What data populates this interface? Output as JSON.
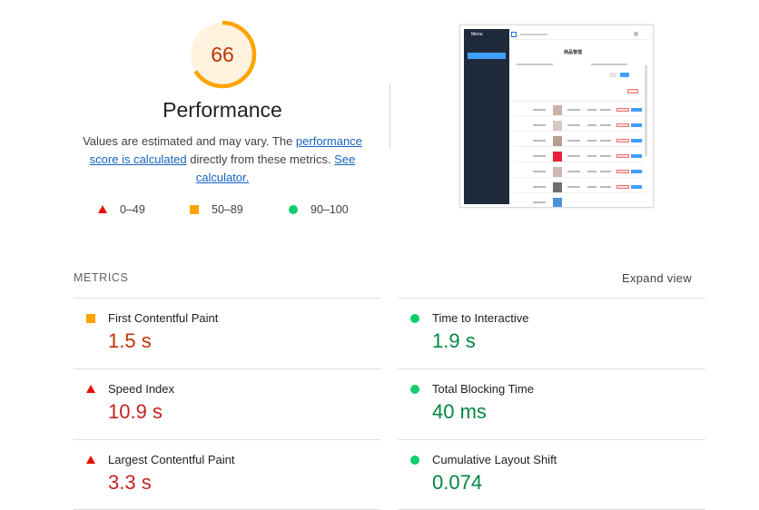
{
  "performance": {
    "score": "66",
    "score_fraction": 0.66,
    "gauge_color": "#ffa400",
    "title": "Performance",
    "desc_prefix": "Values are estimated and may vary. The ",
    "desc_link1": "performance score is calculated",
    "desc_middle": " directly from these metrics. ",
    "desc_link2": "See calculator."
  },
  "legend": [
    {
      "shape": "triangle",
      "color": "#eb0f00",
      "label": "0–49"
    },
    {
      "shape": "square",
      "color": "#ffa400",
      "label": "50–89"
    },
    {
      "shape": "circle",
      "color": "#0cce6b",
      "label": "90–100"
    }
  ],
  "thumbnail": {
    "menu_title": "Menu",
    "page_title": "商品管理"
  },
  "metrics_section": {
    "header": "METRICS",
    "expand_label": "Expand view"
  },
  "metrics": [
    {
      "label": "First Contentful Paint",
      "value": "1.5 s",
      "rating": "average"
    },
    {
      "label": "Time to Interactive",
      "value": "1.9 s",
      "rating": "pass"
    },
    {
      "label": "Speed Index",
      "value": "10.9 s",
      "rating": "fail"
    },
    {
      "label": "Total Blocking Time",
      "value": "40 ms",
      "rating": "pass"
    },
    {
      "label": "Largest Contentful Paint",
      "value": "3.3 s",
      "rating": "fail"
    },
    {
      "label": "Cumulative Layout Shift",
      "value": "0.074",
      "rating": "pass"
    }
  ]
}
